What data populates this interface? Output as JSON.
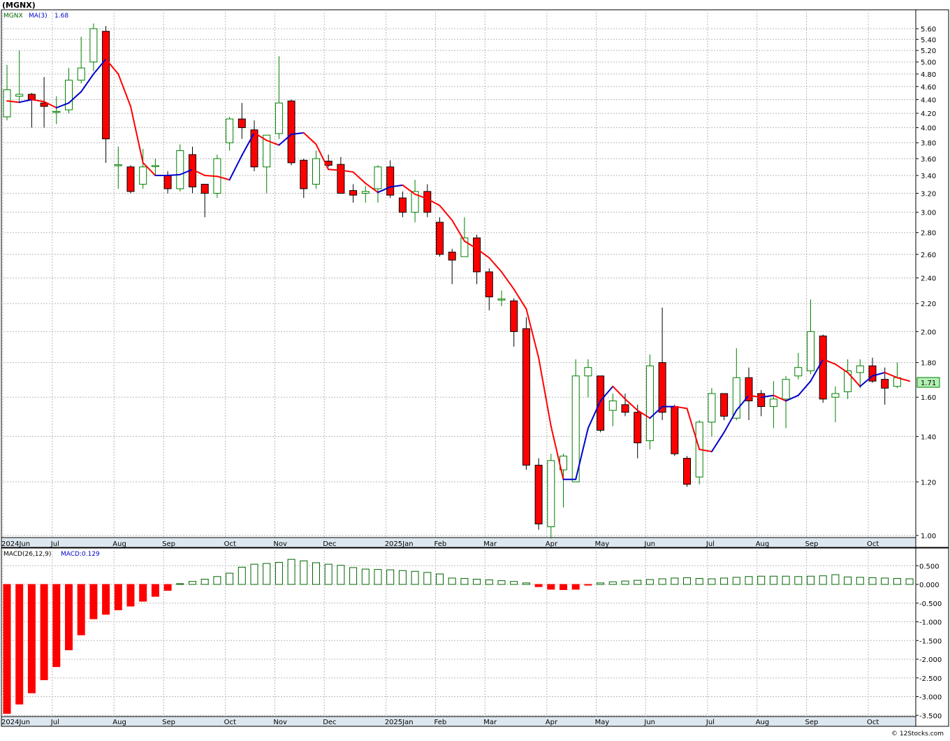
{
  "header": {
    "symbol_label": "(MGNX)",
    "legend_ticker": "MGNX",
    "legend_ma_name": "MA(3)",
    "legend_ma_value": "1.68",
    "macd_label": "MACD(26,12,9)",
    "macd_value_label": "MACD:0.129",
    "last_price_tag": "1.71",
    "watermark": "© 12Stocks.com"
  },
  "colors": {
    "up_candle_stroke": "#008000",
    "down_candle_fill": "#ff0000",
    "ma_up": "#0000cc",
    "ma_down": "#ff0000",
    "macd_pos_stroke": "#006400",
    "macd_neg_fill": "#ff0000",
    "grid": "#b8b8b8",
    "price_tag_bg": "#b3f0b3",
    "axis_strip_bg": "#dde7ef"
  },
  "chart_data": [
    {
      "type": "candlestick",
      "title": "(MGNX)",
      "scale": "log",
      "ylim": [
        0.98,
        5.8
      ],
      "y_ticks": [
        "5.60",
        "5.40",
        "5.20",
        "5.00",
        "4.80",
        "4.60",
        "4.40",
        "4.20",
        "4.00",
        "3.80",
        "3.60",
        "3.40",
        "3.20",
        "3.00",
        "2.80",
        "2.60",
        "2.40",
        "2.20",
        "2.00",
        "1.80",
        "1.60",
        "1.40",
        "1.20",
        "1.00"
      ],
      "x_ticks": [
        {
          "label": "2024Jun",
          "index": 0
        },
        {
          "label": "Jul",
          "index": 4
        },
        {
          "label": "Aug",
          "index": 9
        },
        {
          "label": "Sep",
          "index": 13
        },
        {
          "label": "Oct",
          "index": 18
        },
        {
          "label": "Nov",
          "index": 22
        },
        {
          "label": "Dec",
          "index": 26
        },
        {
          "label": "2025Jan",
          "index": 31
        },
        {
          "label": "Feb",
          "index": 35
        },
        {
          "label": "Mar",
          "index": 39
        },
        {
          "label": "Apr",
          "index": 44
        },
        {
          "label": "May",
          "index": 48
        },
        {
          "label": "Jun",
          "index": 52
        },
        {
          "label": "Jul",
          "index": 57
        },
        {
          "label": "Aug",
          "index": 61
        },
        {
          "label": "Sep",
          "index": 65
        },
        {
          "label": "Oct",
          "index": 70
        }
      ],
      "grid": true,
      "candles": [
        {
          "o": 4.15,
          "h": 4.95,
          "l": 4.1,
          "c": 4.55
        },
        {
          "o": 4.45,
          "h": 5.2,
          "l": 4.35,
          "c": 4.48
        },
        {
          "o": 4.48,
          "h": 4.5,
          "l": 4.0,
          "c": 4.4
        },
        {
          "o": 4.35,
          "h": 4.75,
          "l": 4.0,
          "c": 4.3
        },
        {
          "o": 4.22,
          "h": 4.45,
          "l": 4.05,
          "c": 4.22
        },
        {
          "o": 4.25,
          "h": 4.9,
          "l": 4.2,
          "c": 4.7
        },
        {
          "o": 4.7,
          "h": 5.45,
          "l": 4.65,
          "c": 4.9
        },
        {
          "o": 5.0,
          "h": 5.7,
          "l": 4.85,
          "c": 5.6
        },
        {
          "o": 5.55,
          "h": 5.65,
          "l": 3.55,
          "c": 3.85
        },
        {
          "o": 3.52,
          "h": 3.75,
          "l": 3.25,
          "c": 3.52
        },
        {
          "o": 3.5,
          "h": 3.52,
          "l": 3.2,
          "c": 3.22
        },
        {
          "o": 3.3,
          "h": 3.72,
          "l": 3.25,
          "c": 3.5
        },
        {
          "o": 3.51,
          "h": 3.6,
          "l": 3.4,
          "c": 3.51
        },
        {
          "o": 3.4,
          "h": 3.45,
          "l": 3.2,
          "c": 3.25
        },
        {
          "o": 3.25,
          "h": 3.78,
          "l": 3.22,
          "c": 3.7
        },
        {
          "o": 3.65,
          "h": 3.75,
          "l": 3.2,
          "c": 3.27
        },
        {
          "o": 3.3,
          "h": 3.3,
          "l": 2.95,
          "c": 3.2
        },
        {
          "o": 3.2,
          "h": 3.65,
          "l": 3.15,
          "c": 3.6
        },
        {
          "o": 3.8,
          "h": 4.15,
          "l": 3.7,
          "c": 4.12
        },
        {
          "o": 4.12,
          "h": 4.35,
          "l": 3.85,
          "c": 4.0
        },
        {
          "o": 3.97,
          "h": 4.1,
          "l": 3.45,
          "c": 3.5
        },
        {
          "o": 3.5,
          "h": 3.9,
          "l": 3.2,
          "c": 3.9
        },
        {
          "o": 3.92,
          "h": 5.1,
          "l": 3.85,
          "c": 4.35
        },
        {
          "o": 4.38,
          "h": 4.4,
          "l": 3.52,
          "c": 3.55
        },
        {
          "o": 3.58,
          "h": 3.6,
          "l": 3.15,
          "c": 3.25
        },
        {
          "o": 3.3,
          "h": 3.7,
          "l": 3.25,
          "c": 3.6
        },
        {
          "o": 3.57,
          "h": 3.65,
          "l": 3.5,
          "c": 3.52
        },
        {
          "o": 3.53,
          "h": 3.62,
          "l": 3.2,
          "c": 3.2
        },
        {
          "o": 3.23,
          "h": 3.3,
          "l": 3.1,
          "c": 3.18
        },
        {
          "o": 3.2,
          "h": 3.28,
          "l": 3.1,
          "c": 3.22
        },
        {
          "o": 3.25,
          "h": 3.52,
          "l": 3.1,
          "c": 3.5
        },
        {
          "o": 3.5,
          "h": 3.58,
          "l": 3.15,
          "c": 3.18
        },
        {
          "o": 3.15,
          "h": 3.22,
          "l": 2.95,
          "c": 3.0
        },
        {
          "o": 3.0,
          "h": 3.35,
          "l": 2.9,
          "c": 3.22
        },
        {
          "o": 3.22,
          "h": 3.3,
          "l": 2.95,
          "c": 3.0
        },
        {
          "o": 2.9,
          "h": 2.95,
          "l": 2.58,
          "c": 2.6
        },
        {
          "o": 2.62,
          "h": 2.65,
          "l": 2.35,
          "c": 2.55
        },
        {
          "o": 2.58,
          "h": 2.95,
          "l": 2.58,
          "c": 2.75
        },
        {
          "o": 2.75,
          "h": 2.78,
          "l": 2.35,
          "c": 2.45
        },
        {
          "o": 2.45,
          "h": 2.48,
          "l": 2.15,
          "c": 2.25
        },
        {
          "o": 2.23,
          "h": 2.3,
          "l": 2.18,
          "c": 2.23
        },
        {
          "o": 2.22,
          "h": 2.24,
          "l": 1.9,
          "c": 2.0
        },
        {
          "o": 2.02,
          "h": 2.1,
          "l": 1.25,
          "c": 1.27
        },
        {
          "o": 1.27,
          "h": 1.3,
          "l": 1.02,
          "c": 1.04
        },
        {
          "o": 1.03,
          "h": 1.32,
          "l": 0.99,
          "c": 1.29
        },
        {
          "o": 1.25,
          "h": 1.32,
          "l": 1.1,
          "c": 1.31
        },
        {
          "o": 1.2,
          "h": 1.82,
          "l": 1.2,
          "c": 1.72
        },
        {
          "o": 1.72,
          "h": 1.82,
          "l": 1.6,
          "c": 1.77
        },
        {
          "o": 1.72,
          "h": 1.72,
          "l": 1.42,
          "c": 1.43
        },
        {
          "o": 1.53,
          "h": 1.62,
          "l": 1.45,
          "c": 1.58
        },
        {
          "o": 1.56,
          "h": 1.62,
          "l": 1.5,
          "c": 1.52
        },
        {
          "o": 1.52,
          "h": 1.56,
          "l": 1.3,
          "c": 1.37
        },
        {
          "o": 1.38,
          "h": 1.85,
          "l": 1.34,
          "c": 1.78
        },
        {
          "o": 1.8,
          "h": 2.17,
          "l": 1.48,
          "c": 1.52
        },
        {
          "o": 1.55,
          "h": 1.56,
          "l": 1.31,
          "c": 1.32
        },
        {
          "o": 1.3,
          "h": 1.31,
          "l": 1.18,
          "c": 1.19
        },
        {
          "o": 1.22,
          "h": 1.48,
          "l": 1.19,
          "c": 1.47
        },
        {
          "o": 1.47,
          "h": 1.65,
          "l": 1.4,
          "c": 1.62
        },
        {
          "o": 1.62,
          "h": 1.62,
          "l": 1.48,
          "c": 1.5
        },
        {
          "o": 1.49,
          "h": 1.89,
          "l": 1.48,
          "c": 1.71
        },
        {
          "o": 1.71,
          "h": 1.77,
          "l": 1.48,
          "c": 1.58
        },
        {
          "o": 1.62,
          "h": 1.64,
          "l": 1.5,
          "c": 1.55
        },
        {
          "o": 1.55,
          "h": 1.69,
          "l": 1.44,
          "c": 1.59
        },
        {
          "o": 1.59,
          "h": 1.72,
          "l": 1.44,
          "c": 1.7
        },
        {
          "o": 1.72,
          "h": 1.86,
          "l": 1.7,
          "c": 1.77
        },
        {
          "o": 1.75,
          "h": 2.23,
          "l": 1.73,
          "c": 2.0
        },
        {
          "o": 1.97,
          "h": 1.98,
          "l": 1.57,
          "c": 1.59
        },
        {
          "o": 1.6,
          "h": 1.66,
          "l": 1.47,
          "c": 1.62
        },
        {
          "o": 1.63,
          "h": 1.82,
          "l": 1.59,
          "c": 1.75
        },
        {
          "o": 1.74,
          "h": 1.82,
          "l": 1.65,
          "c": 1.78
        },
        {
          "o": 1.78,
          "h": 1.83,
          "l": 1.68,
          "c": 1.69
        },
        {
          "o": 1.7,
          "h": 1.77,
          "l": 1.56,
          "c": 1.65
        },
        {
          "o": 1.66,
          "h": 1.8,
          "l": 1.65,
          "c": 1.71
        }
      ],
      "ma3": [
        4.38,
        4.36,
        4.4,
        4.37,
        4.28,
        4.35,
        4.52,
        4.8,
        5.05,
        4.8,
        4.3,
        3.55,
        3.4,
        3.4,
        3.41,
        3.47,
        3.4,
        3.39,
        3.35,
        3.64,
        3.93,
        3.83,
        3.77,
        3.91,
        3.93,
        3.78,
        3.47,
        3.46,
        3.44,
        3.31,
        3.21,
        3.27,
        3.29,
        3.19,
        3.14,
        3.07,
        2.92,
        2.72,
        2.65,
        2.57,
        2.45,
        2.31,
        2.16,
        1.83,
        1.45,
        1.21,
        1.21,
        1.44,
        1.58,
        1.66,
        1.59,
        1.53,
        1.49,
        1.55,
        1.55,
        1.54,
        1.34,
        1.33,
        1.42,
        1.53,
        1.61,
        1.6,
        1.61,
        1.58,
        1.61,
        1.69,
        1.82,
        1.79,
        1.74,
        1.66,
        1.72,
        1.74,
        1.71,
        1.69
      ],
      "ma_dir": [
        "d",
        "d",
        "u",
        "d",
        "d",
        "u",
        "u",
        "u",
        "u",
        "d",
        "d",
        "d",
        "d",
        "u",
        "d",
        "u",
        "d",
        "d",
        "u",
        "u",
        "u",
        "d",
        "u",
        "u",
        "d",
        "d",
        "d",
        "d",
        "d",
        "d",
        "u",
        "d",
        "d",
        "d",
        "d",
        "d",
        "d",
        "d",
        "d",
        "d",
        "d",
        "d",
        "d",
        "d",
        "d",
        "d",
        "u",
        "u",
        "u",
        "d",
        "d",
        "d",
        "u",
        "u",
        "d",
        "d",
        "u",
        "u",
        "u",
        "u",
        "d",
        "u",
        "d",
        "u",
        "u",
        "u",
        "d",
        "d",
        "u",
        "u",
        "d",
        "d",
        "d"
      ]
    },
    {
      "type": "bar",
      "title": "MACD(26,12,9)",
      "ylim": [
        -3.6,
        0.75
      ],
      "y_ticks": [
        "0.500",
        "0.000",
        "-0.500",
        "-1.000",
        "-1.500",
        "-2.000",
        "-2.500",
        "-3.000",
        "-3.500"
      ],
      "values": [
        -3.45,
        -3.2,
        -2.9,
        -2.55,
        -2.2,
        -1.75,
        -1.35,
        -0.92,
        -0.8,
        -0.68,
        -0.58,
        -0.45,
        -0.32,
        -0.16,
        0.02,
        0.08,
        0.14,
        0.21,
        0.3,
        0.46,
        0.54,
        0.56,
        0.59,
        0.67,
        0.63,
        0.58,
        0.54,
        0.51,
        0.45,
        0.41,
        0.4,
        0.39,
        0.37,
        0.35,
        0.32,
        0.28,
        0.17,
        0.16,
        0.14,
        0.12,
        0.1,
        0.08,
        0.04,
        -0.06,
        -0.13,
        -0.14,
        -0.13,
        -0.02,
        0.04,
        0.07,
        0.09,
        0.11,
        0.13,
        0.15,
        0.17,
        0.18,
        0.16,
        0.15,
        0.17,
        0.19,
        0.21,
        0.22,
        0.22,
        0.22,
        0.21,
        0.22,
        0.23,
        0.26,
        0.2,
        0.19,
        0.18,
        0.17,
        0.16,
        0.15
      ]
    }
  ]
}
